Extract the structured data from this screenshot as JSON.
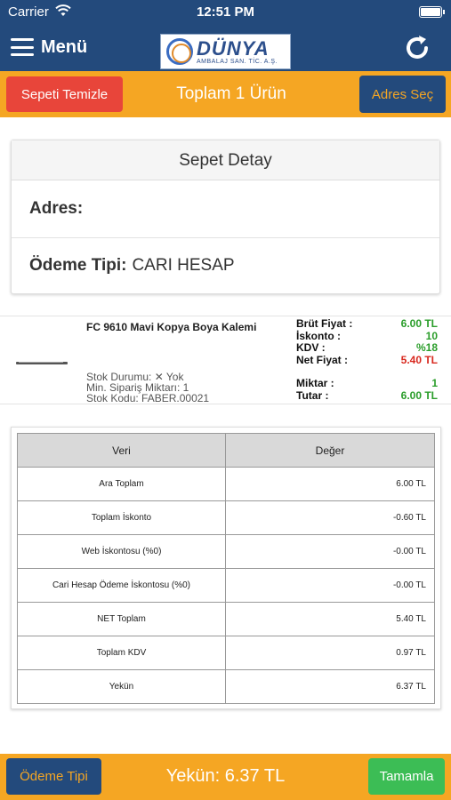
{
  "status_bar": {
    "carrier": "Carrier",
    "time": "12:51 PM"
  },
  "header": {
    "menu_label": "Menü",
    "logo": {
      "name": "DÜNYA",
      "subtitle": "AMBALAJ SAN. TİC. A.Ş."
    }
  },
  "actionbar": {
    "clear_label": "Sepeti Temizle",
    "title": "Toplam 1 Ürün",
    "address_label": "Adres Seç"
  },
  "detail_card": {
    "title": "Sepet Detay",
    "address_label": "Adres:",
    "address_value": "",
    "payment_label": "Ödeme Tipi:",
    "payment_value": "CARI HESAP"
  },
  "product": {
    "name": "FC 9610 Mavi Kopya Boya Kalemi",
    "stock_status": "Stok Durumu: ✕ Yok",
    "min_order": "Min. Sipariş Miktarı: 1",
    "stock_code": "Stok Kodu: FABER.00021",
    "labels": {
      "gross": "Brüt Fiyat :",
      "discount": "İskonto :",
      "vat": "KDV :",
      "net": "Net Fiyat :",
      "qty": "Miktar :",
      "total": "Tutar :"
    },
    "values": {
      "gross": "6.00 TL",
      "discount": "10",
      "vat": "%18",
      "net": "5.40 TL",
      "qty": "1",
      "total": "6.00 TL"
    }
  },
  "summary_table": {
    "headers": [
      "Veri",
      "Değer"
    ],
    "rows": [
      {
        "label": "Ara Toplam",
        "value": "6.00 TL"
      },
      {
        "label": "Toplam İskonto",
        "value": "-0.60 TL"
      },
      {
        "label": "Web İskontosu (%0)",
        "value": "-0.00 TL"
      },
      {
        "label": "Cari Hesap Ödeme İskontosu (%0)",
        "value": "-0.00 TL"
      },
      {
        "label": "NET Toplam",
        "value": "5.40 TL"
      },
      {
        "label": "Toplam KDV",
        "value": "0.97 TL"
      },
      {
        "label": "Yekün",
        "value": "6.37 TL"
      }
    ]
  },
  "footer": {
    "payment_label": "Ödeme Tipi",
    "grand_total": "Yekün: 6.37 TL",
    "complete_label": "Tamamla"
  },
  "colors": {
    "header_blue": "#234a7c",
    "accent_orange": "#f5a623",
    "danger_red": "#e8453a",
    "success_green": "#3cbd55"
  }
}
